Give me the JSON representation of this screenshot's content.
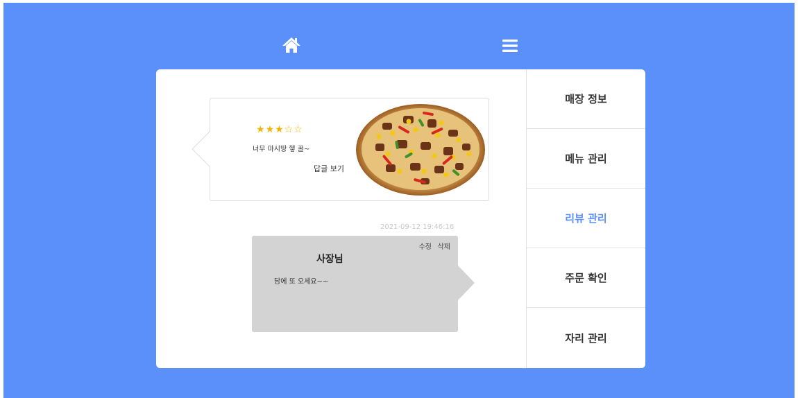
{
  "header": {
    "home_icon": "home-icon",
    "menu_icon": "hamburger-menu-icon"
  },
  "side_menu": {
    "items": [
      {
        "label": "매장 정보",
        "active": false
      },
      {
        "label": "메뉴 관리",
        "active": false
      },
      {
        "label": "리뷰 관리",
        "active": true
      },
      {
        "label": "주문 확인",
        "active": false
      },
      {
        "label": "자리 관리",
        "active": false
      }
    ]
  },
  "review": {
    "rating": 3,
    "rating_max": 5,
    "text": "너무 마시땅 헿 꿀~",
    "view_reply_label": "답글 보기",
    "image": "pizza-photo"
  },
  "reply": {
    "timestamp": "2021-09-12 19:46:16",
    "edit_label": "수정",
    "delete_label": "삭제",
    "author": "사장님",
    "text": "담에 또 오세요~~"
  },
  "colors": {
    "background": "#5b8ffa",
    "accent": "#5b8ffa",
    "star": "#f2b600",
    "reply_bubble": "#d3d3d3"
  }
}
